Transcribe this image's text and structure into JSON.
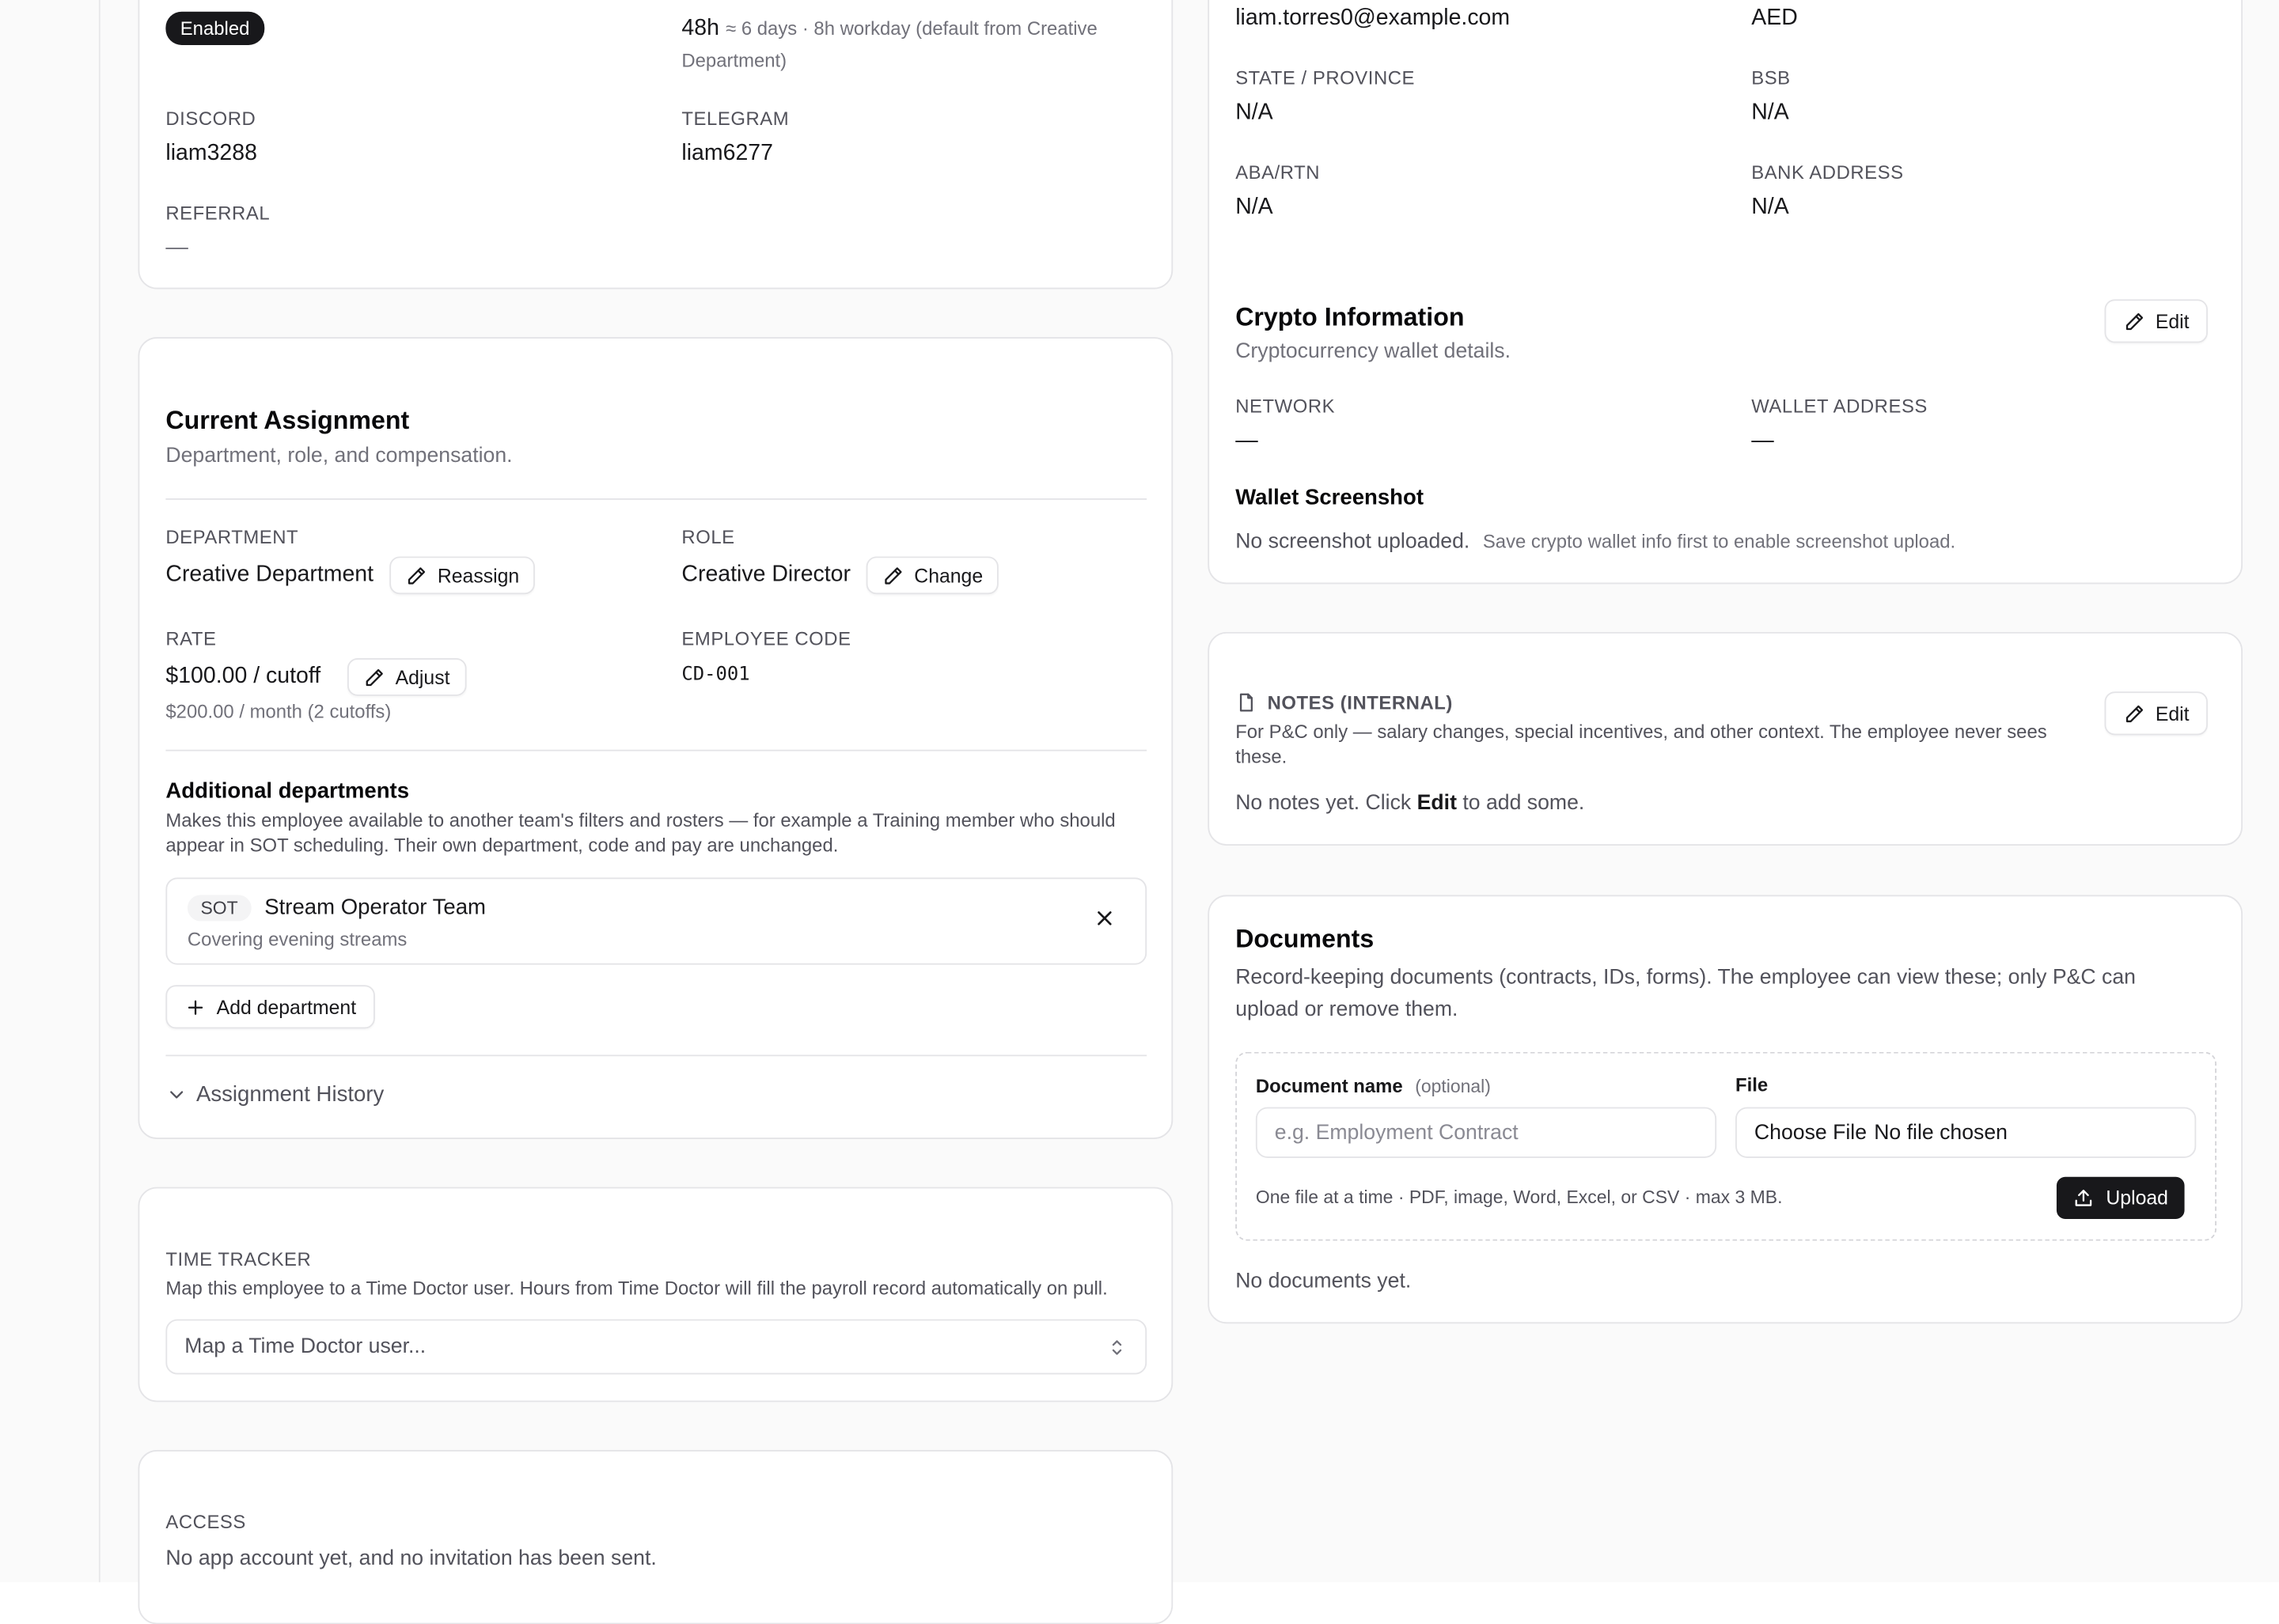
{
  "left": {
    "profile": {
      "status_badge": "Enabled",
      "workday_hours": "48h",
      "workday_detail": "≈ 6 days · 8h workday (default from Creative",
      "workday_detail_2": "Department)",
      "discord_label": "DISCORD",
      "discord_value": "liam3288",
      "telegram_label": "TELEGRAM",
      "telegram_value": "liam6277",
      "referral_label": "REFERRAL",
      "referral_value": "—"
    },
    "assignment": {
      "title": "Current Assignment",
      "subtitle": "Department, role, and compensation.",
      "department_label": "DEPARTMENT",
      "department_value": "Creative Department",
      "reassign_label": "Reassign",
      "role_label": "ROLE",
      "role_value": "Creative Director",
      "change_label": "Change",
      "rate_label": "RATE",
      "rate_value": "$100.00 / cutoff",
      "adjust_label": "Adjust",
      "rate_monthly": "$200.00 / month (2 cutoffs)",
      "code_label": "EMPLOYEE CODE",
      "code_value": "CD-001",
      "additional_title": "Additional departments",
      "additional_desc_1": "Makes this employee available to another team's filters and rosters — for example a Training member who should",
      "additional_desc_2": "appear in SOT scheduling. Their own department, code and pay are unchanged.",
      "extra_dept": {
        "code": "SOT",
        "name": "Stream Operator Team",
        "note": "Covering evening streams"
      },
      "add_department_label": "Add department",
      "history_label": "Assignment History"
    },
    "time_tracker": {
      "label": "TIME TRACKER",
      "desc": "Map this employee to a Time Doctor user. Hours from Time Doctor will fill the payroll record automatically on pull.",
      "select_placeholder": "Map a Time Doctor user..."
    },
    "access": {
      "label": "ACCESS",
      "desc": "No app account yet, and no invitation has been sent."
    }
  },
  "right": {
    "bank": {
      "email_value": "liam.torres0@example.com",
      "currency_value": "AED",
      "state_label": "STATE / PROVINCE",
      "state_value": "N/A",
      "bsb_label": "BSB",
      "bsb_value": "N/A",
      "aba_label": "ABA/RTN",
      "aba_value": "N/A",
      "bank_address_label": "BANK ADDRESS",
      "bank_address_value": "N/A"
    },
    "crypto": {
      "title": "Crypto Information",
      "subtitle": "Cryptocurrency wallet details.",
      "edit_label": "Edit",
      "network_label": "NETWORK",
      "network_value": "—",
      "wallet_label": "WALLET ADDRESS",
      "wallet_value": "—",
      "screenshot_title": "Wallet Screenshot",
      "screenshot_status": "No screenshot uploaded.",
      "screenshot_hint": "Save crypto wallet info first to enable screenshot upload."
    },
    "notes": {
      "label": "NOTES (INTERNAL)",
      "desc_1": "For P&C only — salary changes, special incentives, and other context. The employee never sees",
      "desc_2": "these.",
      "edit_label": "Edit",
      "empty_pre": "No notes yet. Click",
      "empty_link": "Edit",
      "empty_post": "to add some."
    },
    "documents": {
      "title": "Documents",
      "desc_1": "Record-keeping documents (contracts, IDs, forms). The employee can view these; only P&C can",
      "desc_2": "upload or remove them.",
      "name_label": "Document name",
      "name_optional": "(optional)",
      "name_placeholder": "e.g. Employment Contract",
      "file_label": "File",
      "choose_file": "Choose File",
      "no_file": "No file chosen",
      "hint": "One file at a time · PDF, image, Word, Excel, or CSV · max 3 MB.",
      "upload_label": "Upload",
      "empty": "No documents yet."
    }
  },
  "colors": {
    "primary": "#18181b",
    "border": "#e4e4e7",
    "muted_text": "#71717a",
    "background": "#fafafa"
  }
}
